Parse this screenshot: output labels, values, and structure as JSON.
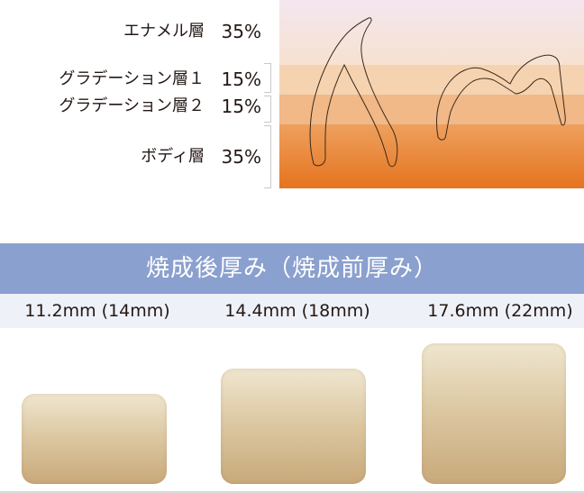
{
  "layers": [
    {
      "name": "エナメル層",
      "percent": "35%"
    },
    {
      "name": "グラデーション層１",
      "percent": "15%"
    },
    {
      "name": "グラデーション層２",
      "percent": "15%"
    },
    {
      "name": "ボディ層",
      "percent": "35%"
    }
  ],
  "colors": {
    "enamel_top": "#f3e6ef",
    "enamel_bottom": "#f7e2d0",
    "gradation1": "#f6d3b0",
    "gradation2": "#f1b888",
    "body_top": "#eea05e",
    "body_bottom": "#e5741f",
    "header": "#8aa0cf",
    "size_band": "#eef1f8"
  },
  "thickness": {
    "title": "焼成後厚み（焼成前厚み）",
    "sizes": [
      {
        "label": "11.2mm (14mm)"
      },
      {
        "label": "14.4mm (18mm)"
      },
      {
        "label": "17.6mm (22mm)"
      }
    ]
  }
}
